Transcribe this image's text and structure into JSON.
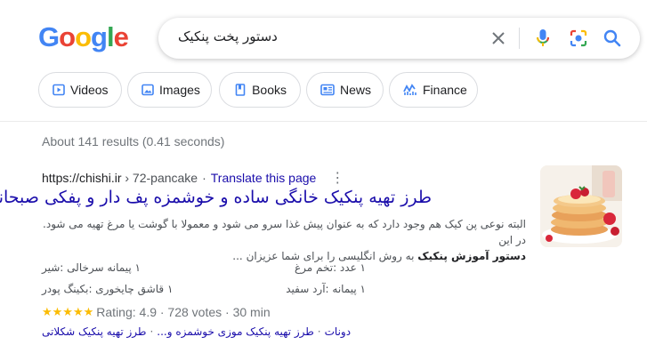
{
  "logo": {
    "letters": [
      "G",
      "o",
      "o",
      "g",
      "l",
      "e"
    ],
    "colors": [
      "#4285F4",
      "#EA4335",
      "#FBBC05",
      "#4285F4",
      "#34A853",
      "#EA4335"
    ]
  },
  "search": {
    "query": "دستور پخت پنکیک",
    "icons": [
      "clear-icon",
      "microphone-icon",
      "camera-lens-icon",
      "search-icon"
    ]
  },
  "chips": [
    {
      "label": "Videos",
      "icon": "play-icon"
    },
    {
      "label": "Images",
      "icon": "image-icon"
    },
    {
      "label": "Books",
      "icon": "book-icon"
    },
    {
      "label": "News",
      "icon": "news-icon"
    },
    {
      "label": "Finance",
      "icon": "finance-chart-icon"
    }
  ],
  "stats": "About 141 results (0.41 seconds)",
  "result": {
    "site": "https://chishi.ir",
    "path": "› 72-pancake",
    "dot": "·",
    "translate": "Translate this page",
    "title": "طرز تهیه پنکیک خانگی ساده و خوشمزه پف دار و پفکی صبحانه",
    "snippet_line1": "البته نوعی پن کیک هم وجود دارد که به عنوان پیش غذا سرو می شود و معمولا با گوشت یا مرغ تهیه می شود. در این",
    "snippet_bold": "دستور آموزش پنکیک",
    "snippet_line2_rest": "به روش انگلیسی را برای شما عزیزان",
    "snippet_ellipsis": "...",
    "ingredients": [
      "۱ عدد :تخم مرغ",
      "۱ پیمانه سرخالی :شیر",
      "۱ پیمانه :آرد سفید",
      "۱ قاشق چایخوری :بکینگ پودر"
    ],
    "rating": {
      "stars": "★★★★★",
      "text": "Rating: 4.9 · 728 votes · 30 min",
      "value": 4.9
    },
    "sitelinks": [
      "دونات",
      "طرز تهیه پنکیک موزی خوشمزه و...",
      "طرز تهیه پنکیک شکلاتی"
    ],
    "sitelink_sep": "·"
  },
  "colors": {
    "link": "#1a0dab",
    "muted": "#70757a",
    "star": "#fbbc04"
  }
}
